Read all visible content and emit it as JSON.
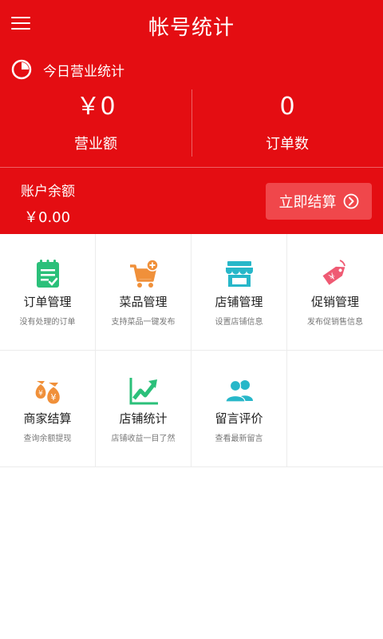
{
  "appbar": {
    "title": "帐号统计",
    "menu_icon": "menu-icon"
  },
  "stats": {
    "heading": "今日营业统计",
    "revenue_value": "￥0",
    "revenue_label": "营业额",
    "orders_value": "0",
    "orders_label": "订单数"
  },
  "balance": {
    "label": "账户余额",
    "value": "￥0.00",
    "settle_label": "立即结算"
  },
  "grid": {
    "items": [
      {
        "name": "订单管理",
        "desc": "没有处理的订单",
        "icon": "clipboard-check-icon",
        "color": "#2bc07a"
      },
      {
        "name": "菜品管理",
        "desc": "支持菜品一键发布",
        "icon": "cart-add-icon",
        "color": "#f0903a"
      },
      {
        "name": "店铺管理",
        "desc": "设置店铺信息",
        "icon": "store-icon",
        "color": "#27b7c9"
      },
      {
        "name": "促销管理",
        "desc": "发布促销售信息",
        "icon": "price-tag-icon",
        "color": "#ef5a73"
      },
      {
        "name": "商家结算",
        "desc": "查询余额提现",
        "icon": "money-bag-icon",
        "color": "#f0903a"
      },
      {
        "name": "店铺统计",
        "desc": "店铺收益一目了然",
        "icon": "trend-chart-icon",
        "color": "#2bc07a"
      },
      {
        "name": "留言评价",
        "desc": "查看最新留言",
        "icon": "users-icon",
        "color": "#27b7c9"
      }
    ]
  },
  "colors": {
    "primary": "#e40d12",
    "button": "#f0474b"
  }
}
